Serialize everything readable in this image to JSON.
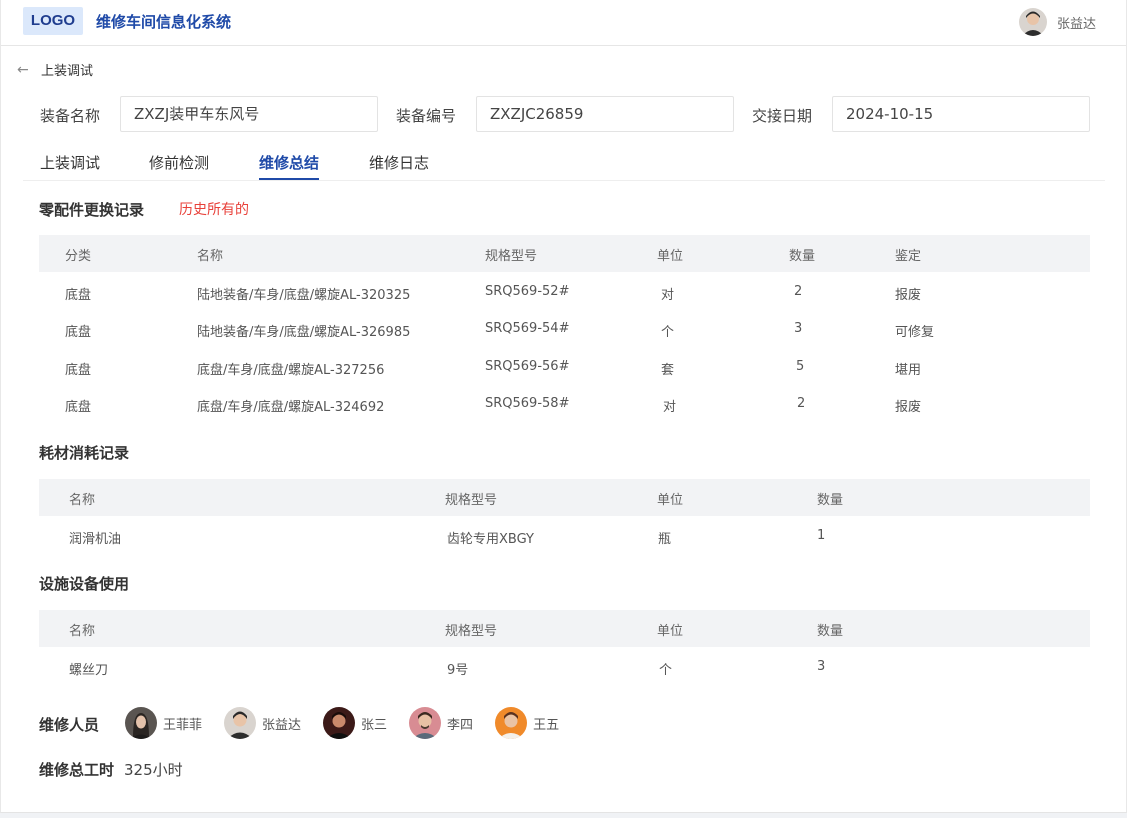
{
  "header": {
    "logo": "LOGO",
    "title": "维修车间信息化系统",
    "user_name": "张益达"
  },
  "back": {
    "label": "上装调试"
  },
  "info": {
    "equipment_name_label": "装备名称",
    "equipment_name_value": "ZXZJ装甲车东风号",
    "equipment_no_label": "装备编号",
    "equipment_no_value": "ZXZJC26859",
    "handover_date_label": "交接日期",
    "handover_date_value": "2024-10-15"
  },
  "tabs": [
    {
      "label": "上装调试"
    },
    {
      "label": "修前检测"
    },
    {
      "label": "维修总结"
    },
    {
      "label": "维修日志"
    }
  ],
  "parts": {
    "title": "零配件更换记录",
    "note": "历史所有的",
    "headers": [
      "分类",
      "名称",
      "规格型号",
      "单位",
      "数量",
      "鉴定"
    ],
    "rows": [
      [
        "底盘",
        "陆地装备/车身/底盘/螺旋AL-320325",
        "SRQ569-52#",
        "对",
        "2",
        "报废"
      ],
      [
        "底盘",
        "陆地装备/车身/底盘/螺旋AL-326985",
        "SRQ569-54#",
        "个",
        "3",
        "可修复"
      ],
      [
        "底盘",
        "底盘/车身/底盘/螺旋AL-327256",
        "SRQ569-56#",
        "套",
        "5",
        "堪用"
      ],
      [
        "底盘",
        "底盘/车身/底盘/螺旋AL-324692",
        "SRQ569-58#",
        "对",
        "2",
        "报废"
      ]
    ]
  },
  "consumables": {
    "title": "耗材消耗记录",
    "headers": [
      "名称",
      "规格型号",
      "单位",
      "数量"
    ],
    "rows": [
      [
        "润滑机油",
        "齿轮专用XBGY",
        "瓶",
        "1"
      ]
    ]
  },
  "facilities": {
    "title": "设施设备使用",
    "headers": [
      "名称",
      "规格型号",
      "单位",
      "数量"
    ],
    "rows": [
      [
        "螺丝刀",
        "9号",
        "个",
        "3"
      ]
    ]
  },
  "staff": {
    "label": "维修人员",
    "members": [
      {
        "name": "王菲菲"
      },
      {
        "name": "张益达"
      },
      {
        "name": "张三"
      },
      {
        "name": "李四"
      },
      {
        "name": "王五"
      }
    ]
  },
  "hours": {
    "label": "维修总工时",
    "value": "325小时"
  },
  "colors": {
    "accent": "#1f4aa8",
    "logo_bg": "#dbe8fb",
    "note_red": "#e8413a",
    "table_header_bg": "#f2f3f5"
  }
}
